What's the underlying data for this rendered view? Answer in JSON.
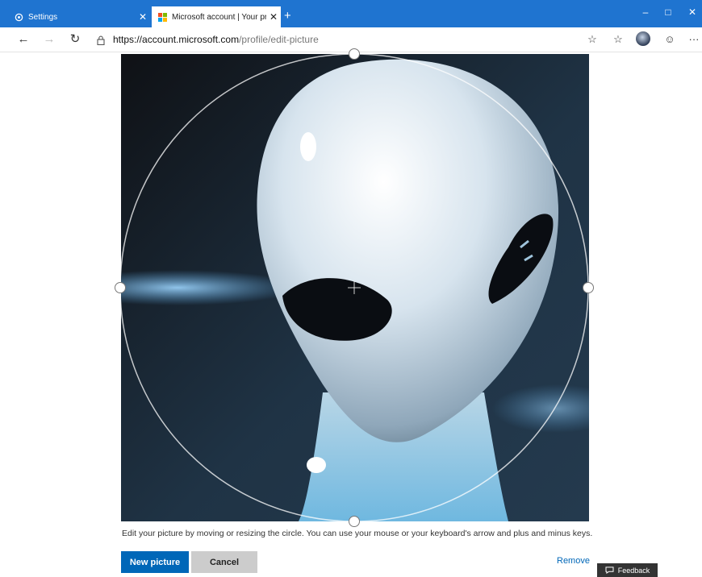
{
  "browser": {
    "tabs": [
      {
        "label": "Settings",
        "active": false
      },
      {
        "label": "Microsoft account | Your profile |",
        "active": true
      }
    ],
    "new_tab_glyph": "+",
    "close_glyph": "✕",
    "window_controls": {
      "minimize": "–",
      "maximize": "□",
      "close": "✕"
    },
    "address": {
      "url_host": "https://account.microsoft.com",
      "url_path": "/profile/edit-picture"
    },
    "nav": {
      "back": "←",
      "forward": "→",
      "refresh": "↻"
    },
    "toolbar": {
      "favorite": "☆",
      "favorites_hub": "☆",
      "emoji": "☺",
      "more": "···"
    },
    "icons": [
      "gear-icon",
      "microsoft-logo-icon",
      "lock-icon",
      "star-icon",
      "favorites-icon",
      "profile-avatar-icon",
      "smiley-icon",
      "more-icon",
      "crosshair-icon",
      "comment-icon"
    ],
    "colors": {
      "titlebar": "#1f74d0",
      "primary": "#0067b8",
      "secondary": "#cccccc",
      "feedback": "#333333"
    }
  },
  "editor": {
    "instruction": "Edit your picture by moving or resizing the circle. You can use your mouse or your keyboard's arrow and plus and minus keys.",
    "new_picture_label": "New picture",
    "cancel_label": "Cancel",
    "remove_label": "Remove"
  },
  "feedback": {
    "label": "Feedback"
  }
}
